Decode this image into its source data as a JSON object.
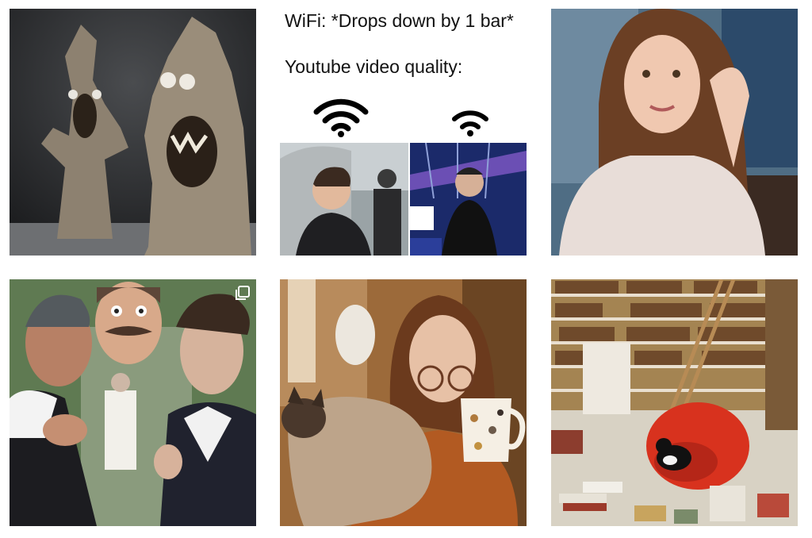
{
  "grid": {
    "posts": [
      {
        "kind": "photo",
        "icon": "none"
      },
      {
        "kind": "meme",
        "caption_line1": "WiFi: *Drops down by 1 bar*",
        "caption_line2": "Youtube video quality:",
        "icons": [
          "wifi-full-icon",
          "wifi-reduced-icon"
        ]
      },
      {
        "kind": "photo",
        "icon": "none"
      },
      {
        "kind": "photo",
        "icon": "multiple-images-icon"
      },
      {
        "kind": "photo",
        "icon": "none"
      },
      {
        "kind": "photo",
        "icon": "none"
      }
    ]
  },
  "colors": {
    "background": "#ffffff",
    "sculpture_bg": "#2a2b2d",
    "sofa_red": "#d8321e",
    "warm_tone": "#b8762e"
  }
}
